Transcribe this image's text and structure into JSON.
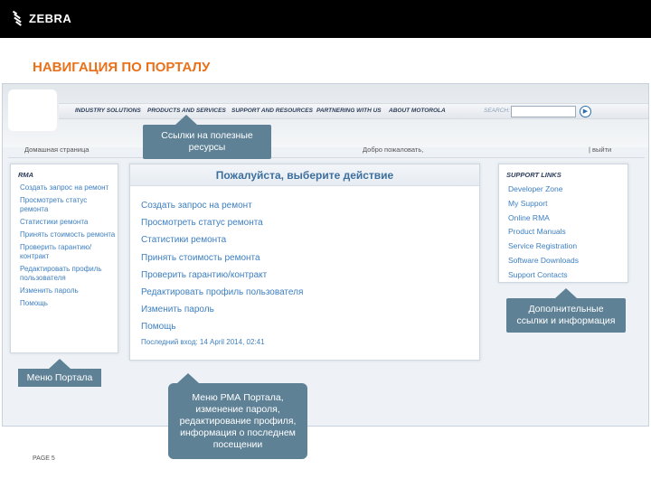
{
  "brand": {
    "logo_text": "ZEBRA"
  },
  "slide": {
    "title": "НАВИГАЦИЯ ПО ПОРТАЛУ",
    "page": "PAGE 5"
  },
  "nav": {
    "items": [
      "INDUSTRY SOLUTIONS",
      "PRODUCTS AND SERVICES",
      "SUPPORT AND RESOURCES",
      "PARTNERING WITH US",
      "ABOUT MOTOROLA"
    ],
    "search_label": "SEARCH:",
    "search_value": ""
  },
  "subbar": {
    "home": "Домашная страница",
    "welcome": "Добро пожаловать,",
    "logout": "| выйти"
  },
  "left_panel": {
    "title": "RMA",
    "items": [
      "Создать запрос на ремонт",
      "Просмотреть статус ремонта",
      "Статистики ремонта",
      "Принять стоимость ремонта",
      "Проверить гарантию/ контракт",
      "Редактировать профиль пользователя",
      "Изменить пароль",
      "Помощь"
    ]
  },
  "main_panel": {
    "title": "Пожалуйста, выберите действие",
    "items": [
      "Создать запрос на ремонт",
      "Просмотреть статус ремонта",
      "Статистики ремонта",
      "Принять стоимость ремонта",
      "Проверить гарантию/контракт",
      "Редактировать профиль пользователя",
      "Изменить пароль",
      "Помощь"
    ],
    "last_login": "Последний вход: 14 April 2014, 02:41"
  },
  "right_panel": {
    "title": "SUPPORT LINKS",
    "items": [
      "Developer Zone",
      "My Support",
      "Online RMA",
      "Product Manuals",
      "Service Registration",
      "Software Downloads",
      "Support Contacts"
    ]
  },
  "callouts": {
    "resources": "Ссылки на полезные ресурсы",
    "additional": "Дополнительные ссылки и информация",
    "portal_menu": "Меню Портала",
    "rma_menu": "Меню РМА Портала, изменение пароля, редактирование профиля, информация о последнем посещении"
  },
  "colors": {
    "accent": "#e8711c",
    "link": "#3d7fc1",
    "callout": "#5e8196",
    "header_bg": "#000000"
  }
}
